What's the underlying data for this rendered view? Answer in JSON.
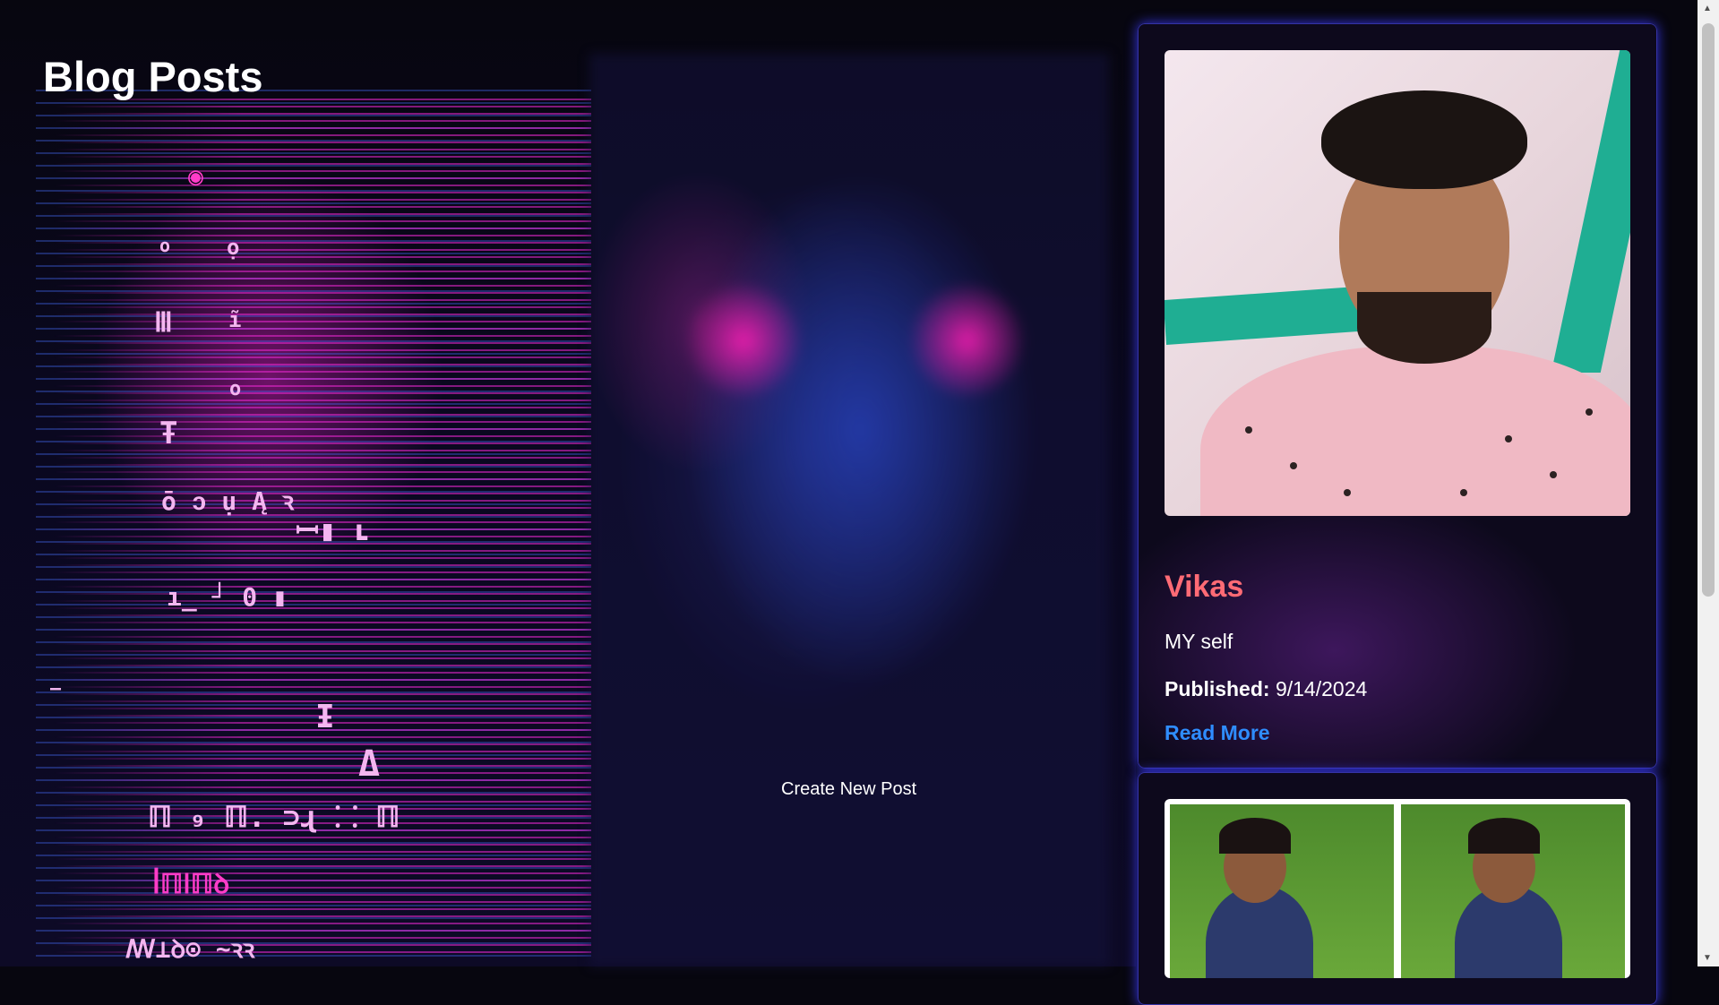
{
  "page": {
    "title": "Blog Posts",
    "create_post_label": "Create New Post"
  },
  "posts": [
    {
      "title": "Vikas",
      "description": "MY self",
      "published_label": "Published:",
      "published_date": "9/14/2024",
      "read_more_label": "Read More"
    }
  ],
  "colors": {
    "post_title": "#ff6b75",
    "link": "#2f8dff",
    "card_glow": "#3c3cff"
  },
  "scrollbar": {
    "up_icon": "chevron-up-icon",
    "down_icon": "chevron-down-icon"
  }
}
